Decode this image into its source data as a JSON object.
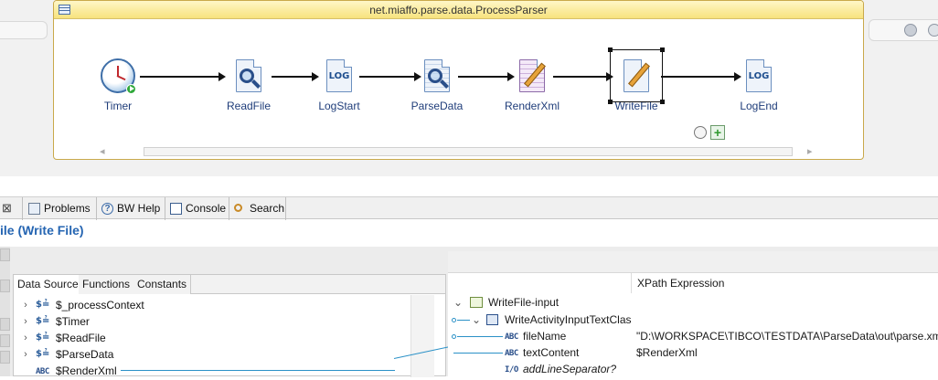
{
  "canvas": {
    "process_title": "net.miaffo.parse.data.ProcessParser",
    "activities": [
      {
        "id": "timer",
        "label": "Timer",
        "icon": "timer-clock-icon"
      },
      {
        "id": "readfile",
        "label": "ReadFile",
        "icon": "read-file-icon"
      },
      {
        "id": "logstart",
        "label": "LogStart",
        "icon": "log-icon",
        "icon_text": "LOG"
      },
      {
        "id": "parsedata",
        "label": "ParseData",
        "icon": "parse-data-icon"
      },
      {
        "id": "renderxml",
        "label": "RenderXml",
        "icon": "render-xml-icon"
      },
      {
        "id": "writefile",
        "label": "WriteFile",
        "icon": "write-file-icon",
        "selected": true
      },
      {
        "id": "logend",
        "label": "LogEnd",
        "icon": "log-icon",
        "icon_text": "LOG"
      }
    ],
    "scroll_arrow_left": "◂",
    "scroll_arrow_right": "▸"
  },
  "tabs": [
    {
      "label": "Problems",
      "icon": "problems-icon"
    },
    {
      "label": "BW Help",
      "icon": "help-icon"
    },
    {
      "label": "Console",
      "icon": "console-icon"
    },
    {
      "label": "Search",
      "icon": "search-icon"
    }
  ],
  "properties": {
    "title": "ile (Write File)"
  },
  "data_source": {
    "tabs": [
      "Data Source",
      "Functions",
      "Constants"
    ],
    "active_tab": "Data Source",
    "rows": [
      {
        "label": "$_processContext",
        "icon": "process-variable-icon",
        "expandable": true
      },
      {
        "label": "$Timer",
        "icon": "process-variable-icon",
        "expandable": true
      },
      {
        "label": "$ReadFile",
        "icon": "process-variable-icon",
        "expandable": true
      },
      {
        "label": "$ParseData",
        "icon": "process-variable-icon",
        "expandable": true
      },
      {
        "label": "$RenderXml",
        "icon": "string-icon",
        "icon_text": "ABC",
        "expandable": false
      }
    ]
  },
  "mapper": {
    "header": "XPath Expression",
    "rows": [
      {
        "label": "WriteFile-input",
        "icon": "schema-icon",
        "expression": ""
      },
      {
        "label": "WriteActivityInputTextClas",
        "icon": "element-icon",
        "expression": ""
      },
      {
        "label": "fileName",
        "icon": "string-icon",
        "icon_text": "ABC",
        "expression": "\"D:\\WORKSPACE\\TIBCO\\TESTDATA\\ParseData\\out\\parse.xml\""
      },
      {
        "label": "textContent",
        "icon": "string-icon",
        "icon_text": "ABC",
        "expression": "$RenderXml"
      },
      {
        "label": "addLineSeparator?",
        "icon": "boolean-icon",
        "icon_text": "I/O",
        "expression": ""
      }
    ]
  },
  "colors": {
    "title_accent": "#2565b2",
    "mapping_line": "#2b91c7",
    "process_border": "#c9a94b"
  }
}
